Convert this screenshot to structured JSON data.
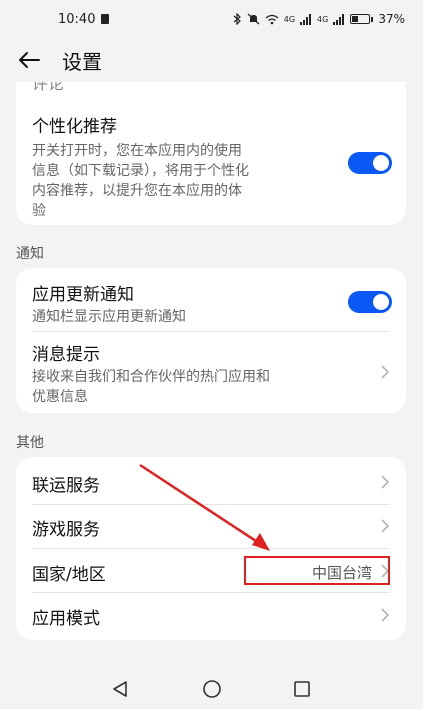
{
  "status_bar": {
    "time": "10:40",
    "network_1": "4G",
    "network_2": "4G",
    "battery": "37%",
    "battery_level": 0.37
  },
  "app_bar": {
    "title": "设置"
  },
  "card1": {
    "partial_item": "评论",
    "personalized": {
      "title": "个性化推荐",
      "desc_lines": [
        "开关打开时，您在本应用内的使用",
        "信息（如下载记录），将用于个性化",
        "内容推荐，以提升您在本应用的体",
        "验"
      ],
      "enabled": true
    }
  },
  "section_notify": {
    "label": "通知"
  },
  "card2": {
    "update_notice": {
      "title": "应用更新通知",
      "desc": "通知栏显示应用更新通知",
      "enabled": true
    },
    "messages": {
      "title": "消息提示",
      "desc_lines": [
        "接收来自我们和合作伙伴的热门应用和",
        "优惠信息"
      ]
    }
  },
  "section_other": {
    "label": "其他"
  },
  "card3": {
    "items": [
      {
        "title": "联运服务"
      },
      {
        "title": "游戏服务"
      },
      {
        "title": "国家/地区",
        "value": "中国台湾"
      },
      {
        "title": "应用模式"
      }
    ]
  },
  "colors": {
    "accent": "#0a59f7",
    "annotation": "#e0201e",
    "background": "#f1f3f5"
  }
}
